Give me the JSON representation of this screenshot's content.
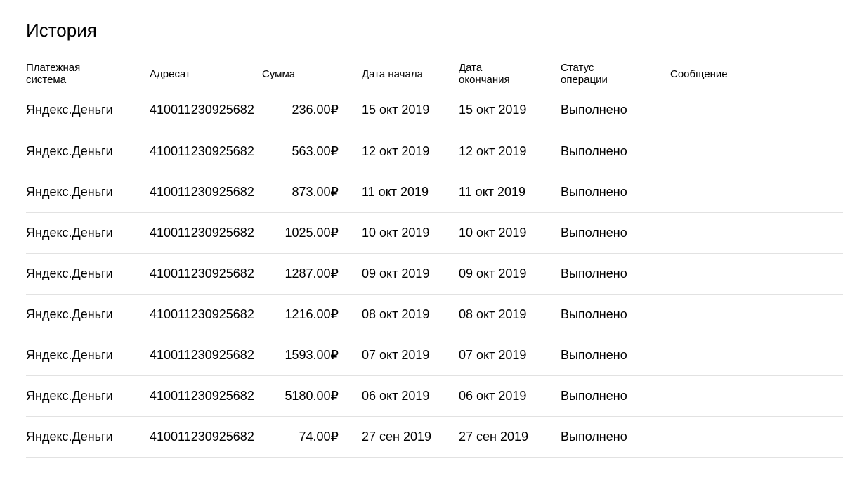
{
  "page": {
    "title": "История"
  },
  "table": {
    "headers": {
      "system": "Платежная система",
      "recipient": "Адресат",
      "amount": "Сумма",
      "start_date": "Дата начала",
      "end_date": "Дата окончания",
      "status": "Статус операции",
      "message": "Сообщение"
    },
    "rows": [
      {
        "system": "Яндекс.Деньги",
        "recipient": "410011230925682",
        "amount": "236.00₽",
        "start_date": "15 окт 2019",
        "end_date": "15 окт 2019",
        "status": "Выполнено",
        "message": ""
      },
      {
        "system": "Яндекс.Деньги",
        "recipient": "410011230925682",
        "amount": "563.00₽",
        "start_date": "12 окт 2019",
        "end_date": "12 окт 2019",
        "status": "Выполнено",
        "message": ""
      },
      {
        "system": "Яндекс.Деньги",
        "recipient": "410011230925682",
        "amount": "873.00₽",
        "start_date": "11 окт 2019",
        "end_date": "11 окт 2019",
        "status": "Выполнено",
        "message": ""
      },
      {
        "system": "Яндекс.Деньги",
        "recipient": "410011230925682",
        "amount": "1025.00₽",
        "start_date": "10 окт 2019",
        "end_date": "10 окт 2019",
        "status": "Выполнено",
        "message": ""
      },
      {
        "system": "Яндекс.Деньги",
        "recipient": "410011230925682",
        "amount": "1287.00₽",
        "start_date": "09 окт 2019",
        "end_date": "09 окт 2019",
        "status": "Выполнено",
        "message": ""
      },
      {
        "system": "Яндекс.Деньги",
        "recipient": "410011230925682",
        "amount": "1216.00₽",
        "start_date": "08 окт 2019",
        "end_date": "08 окт 2019",
        "status": "Выполнено",
        "message": ""
      },
      {
        "system": "Яндекс.Деньги",
        "recipient": "410011230925682",
        "amount": "1593.00₽",
        "start_date": "07 окт 2019",
        "end_date": "07 окт 2019",
        "status": "Выполнено",
        "message": ""
      },
      {
        "system": "Яндекс.Деньги",
        "recipient": "410011230925682",
        "amount": "5180.00₽",
        "start_date": "06 окт 2019",
        "end_date": "06 окт 2019",
        "status": "Выполнено",
        "message": ""
      },
      {
        "system": "Яндекс.Деньги",
        "recipient": "410011230925682",
        "amount": "74.00₽",
        "start_date": "27 сен 2019",
        "end_date": "27 сен 2019",
        "status": "Выполнено",
        "message": ""
      }
    ]
  },
  "colors": {
    "text": "#000000",
    "row_divider": "#e2e2e2",
    "background": "#ffffff"
  }
}
